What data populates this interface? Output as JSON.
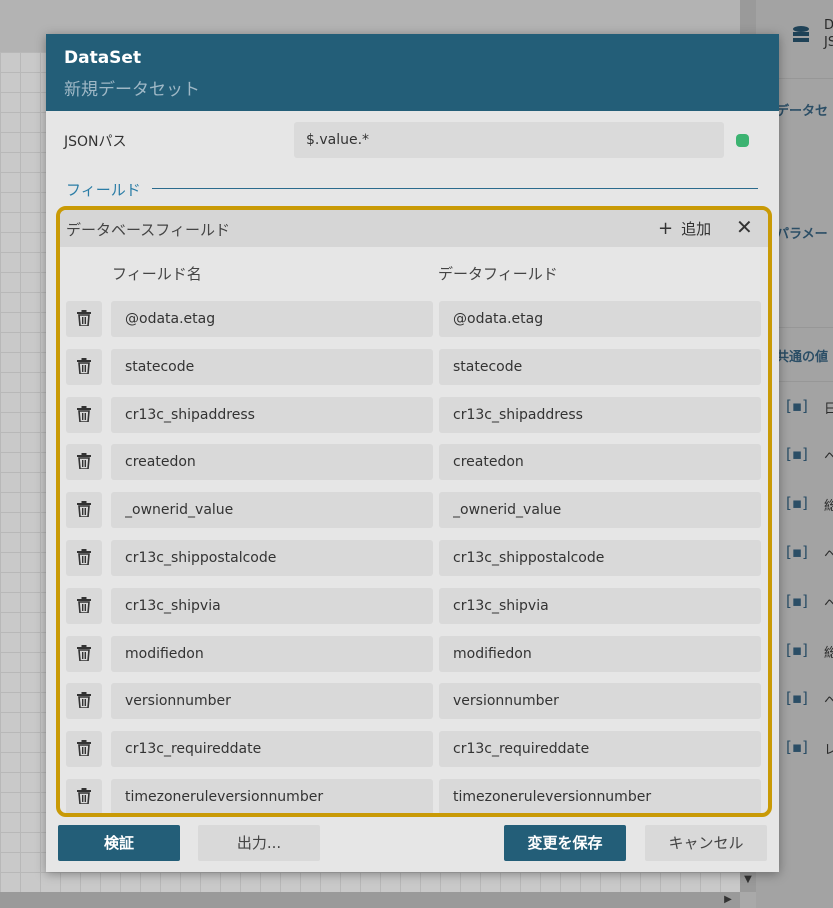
{
  "background": {
    "side_panel": {
      "datasource_letter_1": "D",
      "datasource_letter_2": "JS",
      "section_dataset": "データセ",
      "section_parameters": "パラメー",
      "section_common": "共通の値",
      "common_rows": [
        "日",
        "ヘ",
        "総",
        "ヘ",
        "ヘ",
        "総",
        "ヘ",
        "レ"
      ]
    }
  },
  "dialog": {
    "title": "DataSet",
    "subtitle": "新規データセット",
    "json_path_label": "JSONパス",
    "json_path_value": "$.value.*",
    "status_color": "#3cb371",
    "fields_section_label": "フィールド",
    "panel": {
      "title": "データベースフィールド",
      "add_label": "追加",
      "add_icon": "plus-icon",
      "close_icon": "close-icon",
      "column_field_name": "フィールド名",
      "column_data_field": "データフィールド",
      "rows": [
        {
          "name": "@odata.etag",
          "data": "@odata.etag"
        },
        {
          "name": "statecode",
          "data": "statecode"
        },
        {
          "name": "cr13c_shipaddress",
          "data": "cr13c_shipaddress"
        },
        {
          "name": "createdon",
          "data": "createdon"
        },
        {
          "name": "_ownerid_value",
          "data": "_ownerid_value"
        },
        {
          "name": "cr13c_shippostalcode",
          "data": "cr13c_shippostalcode"
        },
        {
          "name": "cr13c_shipvia",
          "data": "cr13c_shipvia"
        },
        {
          "name": "modifiedon",
          "data": "modifiedon"
        },
        {
          "name": "versionnumber",
          "data": "versionnumber"
        },
        {
          "name": "cr13c_requireddate",
          "data": "cr13c_requireddate"
        },
        {
          "name": "timezoneruleversionnumber",
          "data": "timezoneruleversionnumber"
        }
      ]
    },
    "buttons": {
      "validate": "検証",
      "export": "出力...",
      "save": "変更を保存",
      "cancel": "キャンセル"
    }
  },
  "colors": {
    "header": "#235e78",
    "highlight_border": "#c99a06",
    "accent": "#2b7da6"
  }
}
